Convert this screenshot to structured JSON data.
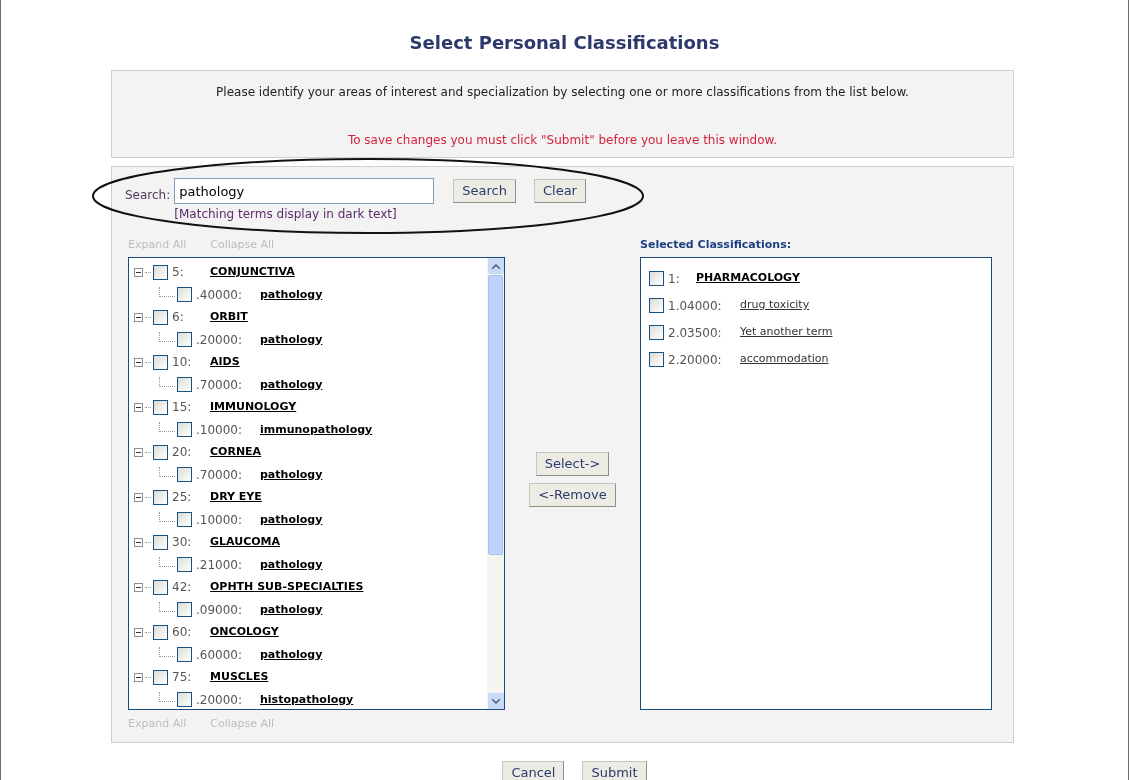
{
  "title": "Select Personal Classifications",
  "intro": "Please identify your areas of interest and specialization by selecting one or more classifications from the list below.",
  "warning": "To save changes you must click \"Submit\" before you leave this window.",
  "search": {
    "label": "Search:",
    "value": "pathology",
    "hint": "[Matching terms display in dark text]",
    "buttons": [
      "Search",
      "Clear"
    ]
  },
  "tree_links_top": [
    {
      "label": "Expand All",
      "disabled": true
    },
    {
      "label": "Collapse All",
      "disabled": true
    }
  ],
  "tree": [
    {
      "code": "5:",
      "label": "CONJUNCTIVA",
      "checked": false,
      "expanded": true,
      "matching": true,
      "children": [
        {
          "code": ".40000:",
          "label": "pathology",
          "checked": false,
          "matching": true
        }
      ]
    },
    {
      "code": "6:",
      "label": "ORBIT",
      "checked": false,
      "expanded": true,
      "matching": true,
      "children": [
        {
          "code": ".20000:",
          "label": "pathology",
          "checked": false,
          "matching": true
        }
      ]
    },
    {
      "code": "10:",
      "label": "AIDS",
      "checked": false,
      "expanded": true,
      "matching": true,
      "children": [
        {
          "code": ".70000:",
          "label": "pathology",
          "checked": false,
          "matching": true
        }
      ]
    },
    {
      "code": "15:",
      "label": "IMMUNOLOGY",
      "checked": false,
      "expanded": true,
      "matching": true,
      "children": [
        {
          "code": ".10000:",
          "label": "immunopathology",
          "checked": false,
          "matching": true
        }
      ]
    },
    {
      "code": "20:",
      "label": "CORNEA",
      "checked": false,
      "expanded": true,
      "matching": true,
      "children": [
        {
          "code": ".70000:",
          "label": "pathology",
          "checked": false,
          "matching": true
        }
      ]
    },
    {
      "code": "25:",
      "label": "DRY EYE",
      "checked": false,
      "expanded": true,
      "matching": true,
      "children": [
        {
          "code": ".10000:",
          "label": "pathology",
          "checked": false,
          "matching": true
        }
      ]
    },
    {
      "code": "30:",
      "label": "GLAUCOMA",
      "checked": false,
      "expanded": true,
      "matching": true,
      "children": [
        {
          "code": ".21000:",
          "label": "pathology",
          "checked": false,
          "matching": true
        }
      ]
    },
    {
      "code": "42:",
      "label": "OPHTH SUB-SPECIALTIES",
      "checked": false,
      "expanded": true,
      "matching": true,
      "children": [
        {
          "code": ".09000:",
          "label": "pathology",
          "checked": false,
          "matching": true
        }
      ]
    },
    {
      "code": "60:",
      "label": "ONCOLOGY",
      "checked": false,
      "expanded": true,
      "matching": true,
      "children": [
        {
          "code": ".60000:",
          "label": "pathology",
          "checked": false,
          "matching": true
        }
      ]
    },
    {
      "code": "75:",
      "label": "MUSCLES",
      "checked": false,
      "expanded": true,
      "matching": true,
      "children": [
        {
          "code": ".20000:",
          "label": "histopathology",
          "checked": false,
          "matching": true
        }
      ]
    }
  ],
  "tree_links_bottom": [
    {
      "label": "Expand All",
      "disabled": true
    },
    {
      "label": "Collapse All",
      "disabled": true
    }
  ],
  "transfer_buttons": [
    "Select->",
    "<-Remove"
  ],
  "selected_heading": "Selected Classifications:",
  "selected": [
    {
      "code": "1:",
      "label": "PHARMACOLOGY",
      "checked": false,
      "matching": true
    },
    {
      "code": "1.04000:",
      "label": "drug toxicity",
      "checked": false,
      "matching": false
    },
    {
      "code": "2.03500:",
      "label": "Yet another term",
      "checked": false,
      "matching": false
    },
    {
      "code": "2.20000:",
      "label": "accommodation",
      "checked": false,
      "matching": false
    }
  ],
  "footer_buttons": [
    "Cancel",
    "Submit"
  ]
}
